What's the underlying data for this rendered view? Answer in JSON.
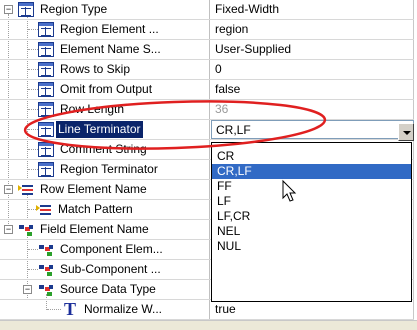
{
  "rows": [
    {
      "name": "Region Type",
      "value": "Fixed-Width"
    },
    {
      "name": "Region Element ...",
      "value": "region"
    },
    {
      "name": "Element Name S...",
      "value": "User-Supplied"
    },
    {
      "name": "Rows to Skip",
      "value": "0"
    },
    {
      "name": "Omit from Output",
      "value": "false"
    },
    {
      "name": "Row Length",
      "value": "36"
    },
    {
      "name": "Line Terminator",
      "value": "CR,LF"
    },
    {
      "name": "Comment String",
      "value": ""
    },
    {
      "name": "Region Terminator",
      "value": ""
    },
    {
      "name": "Row Element Name",
      "value": ""
    },
    {
      "name": "Match Pattern",
      "value": ""
    },
    {
      "name": "Field Element Name",
      "value": ""
    },
    {
      "name": "Component Elem...",
      "value": ""
    },
    {
      "name": "Sub-Component ...",
      "value": ""
    },
    {
      "name": "Source Data Type",
      "value": ""
    },
    {
      "name": "Normalize W...",
      "value": "true"
    }
  ],
  "expanders": {
    "collapse": "−"
  },
  "line_terminator_options": [
    "CR",
    "CR,LF",
    "FF",
    "LF",
    "LF,CR",
    "NEL",
    "NUL"
  ],
  "highlighted_option": "CR,LF",
  "colors": {
    "annotation_red": "#e02020",
    "selection_blue": "#316ac5",
    "icon_blue": "#1b3a8e"
  },
  "icons": {
    "table": "table-grid-icon",
    "row_element": "row-element-icon",
    "field_element": "field-element-icon",
    "text": "text-T-icon"
  }
}
